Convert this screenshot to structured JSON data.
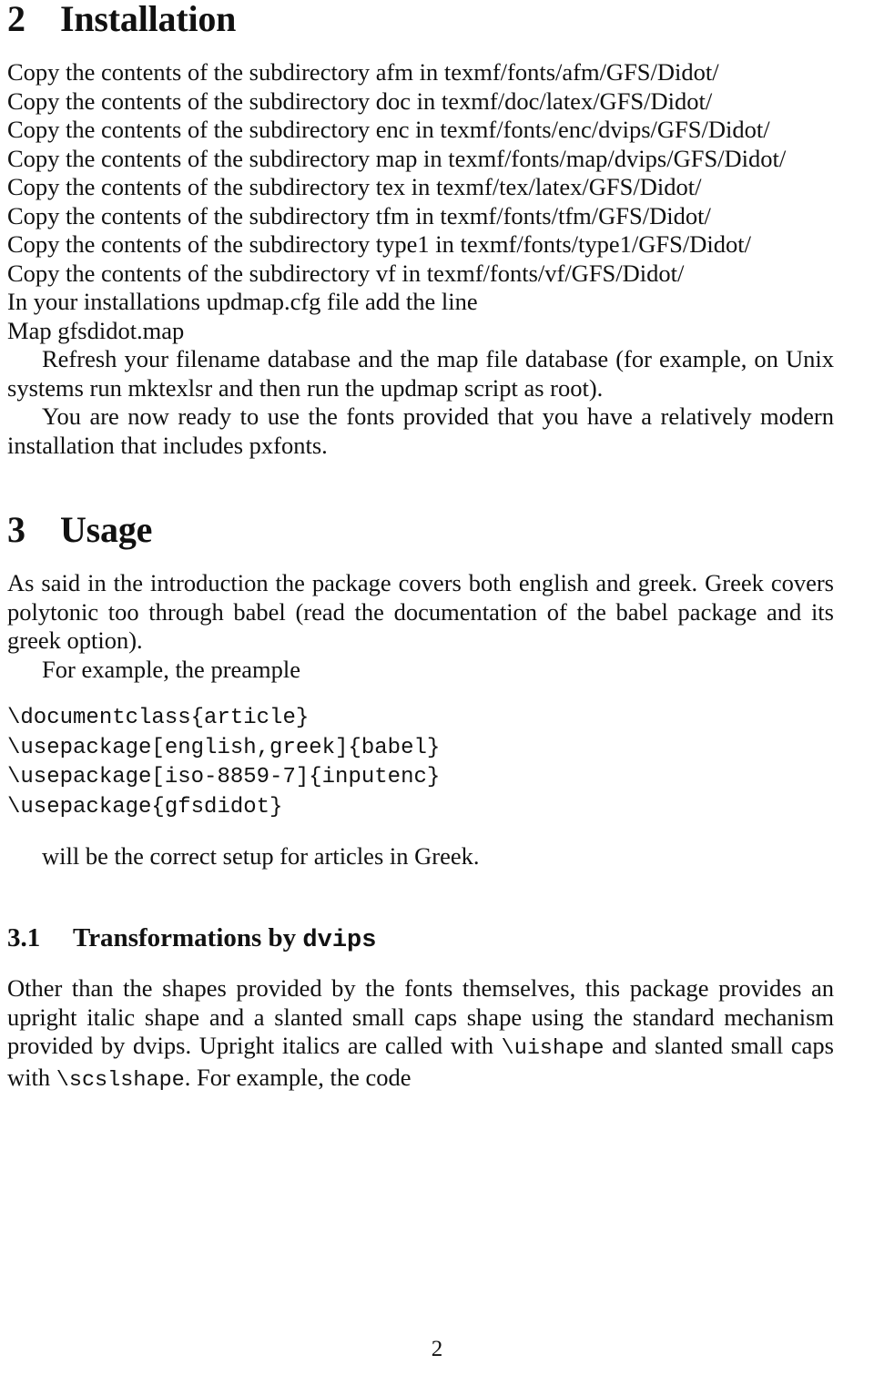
{
  "document": {
    "page_number": "2"
  },
  "sections": {
    "installation": {
      "number": "2",
      "title": "Installation",
      "copy_lines": [
        "Copy the contents of the subdirectory afm in texmf/fonts/afm/GFS/Didot/",
        "Copy the contents of the subdirectory doc in texmf/doc/latex/GFS/Didot/",
        "Copy the contents of the subdirectory enc in texmf/fonts/enc/dvips/GFS/Didot/",
        "Copy the contents of the subdirectory map in texmf/fonts/map/dvips/GFS/Didot/",
        "Copy the contents of the subdirectory tex in texmf/tex/latex/GFS/Didot/",
        "Copy the contents of the subdirectory tfm in texmf/fonts/tfm/GFS/Didot/",
        "Copy the contents of the subdirectory type1 in texmf/fonts/type1/GFS/Didot/",
        "Copy the contents of the subdirectory vf in texmf/fonts/vf/GFS/Didot/"
      ],
      "updmap_instruction": "In your installations updmap.cfg file add the line",
      "map_line": "Map gfsdidot.map",
      "refresh_paragraph": "Refresh your filename database and the map file database (for example, on Unix systems run mktexlsr and then run the updmap script as root).",
      "ready_paragraph": "You are now ready to use the fonts provided that you have a relatively modern installation that includes pxfonts."
    },
    "usage": {
      "number": "3",
      "title": "Usage",
      "intro_paragraph": "As said in the introduction the package covers both english and greek. Greek covers polytonic too through babel (read the documentation of the babel package and its greek option).",
      "example_lead": "For example, the preample",
      "code_block": "\\documentclass{article}\n\\usepackage[english,greek]{babel}\n\\usepackage[iso-8859-7]{inputenc}\n\\usepackage{gfsdidot}",
      "code_trailer": "will be the correct setup for articles in Greek."
    },
    "transformations": {
      "number": "3.1",
      "title_prefix": "Transformations by ",
      "title_mono": "dvips",
      "paragraph_part1": "Other than the shapes provided by the fonts themselves, this package provides an upright italic shape and a slanted small caps shape using the standard mechanism provided by dvips. Upright italics are called with ",
      "inline_code_1": "\\uishape",
      "paragraph_part2": " and slanted small caps with ",
      "inline_code_2": "\\scslshape",
      "paragraph_part3": ". For example, the code"
    }
  }
}
